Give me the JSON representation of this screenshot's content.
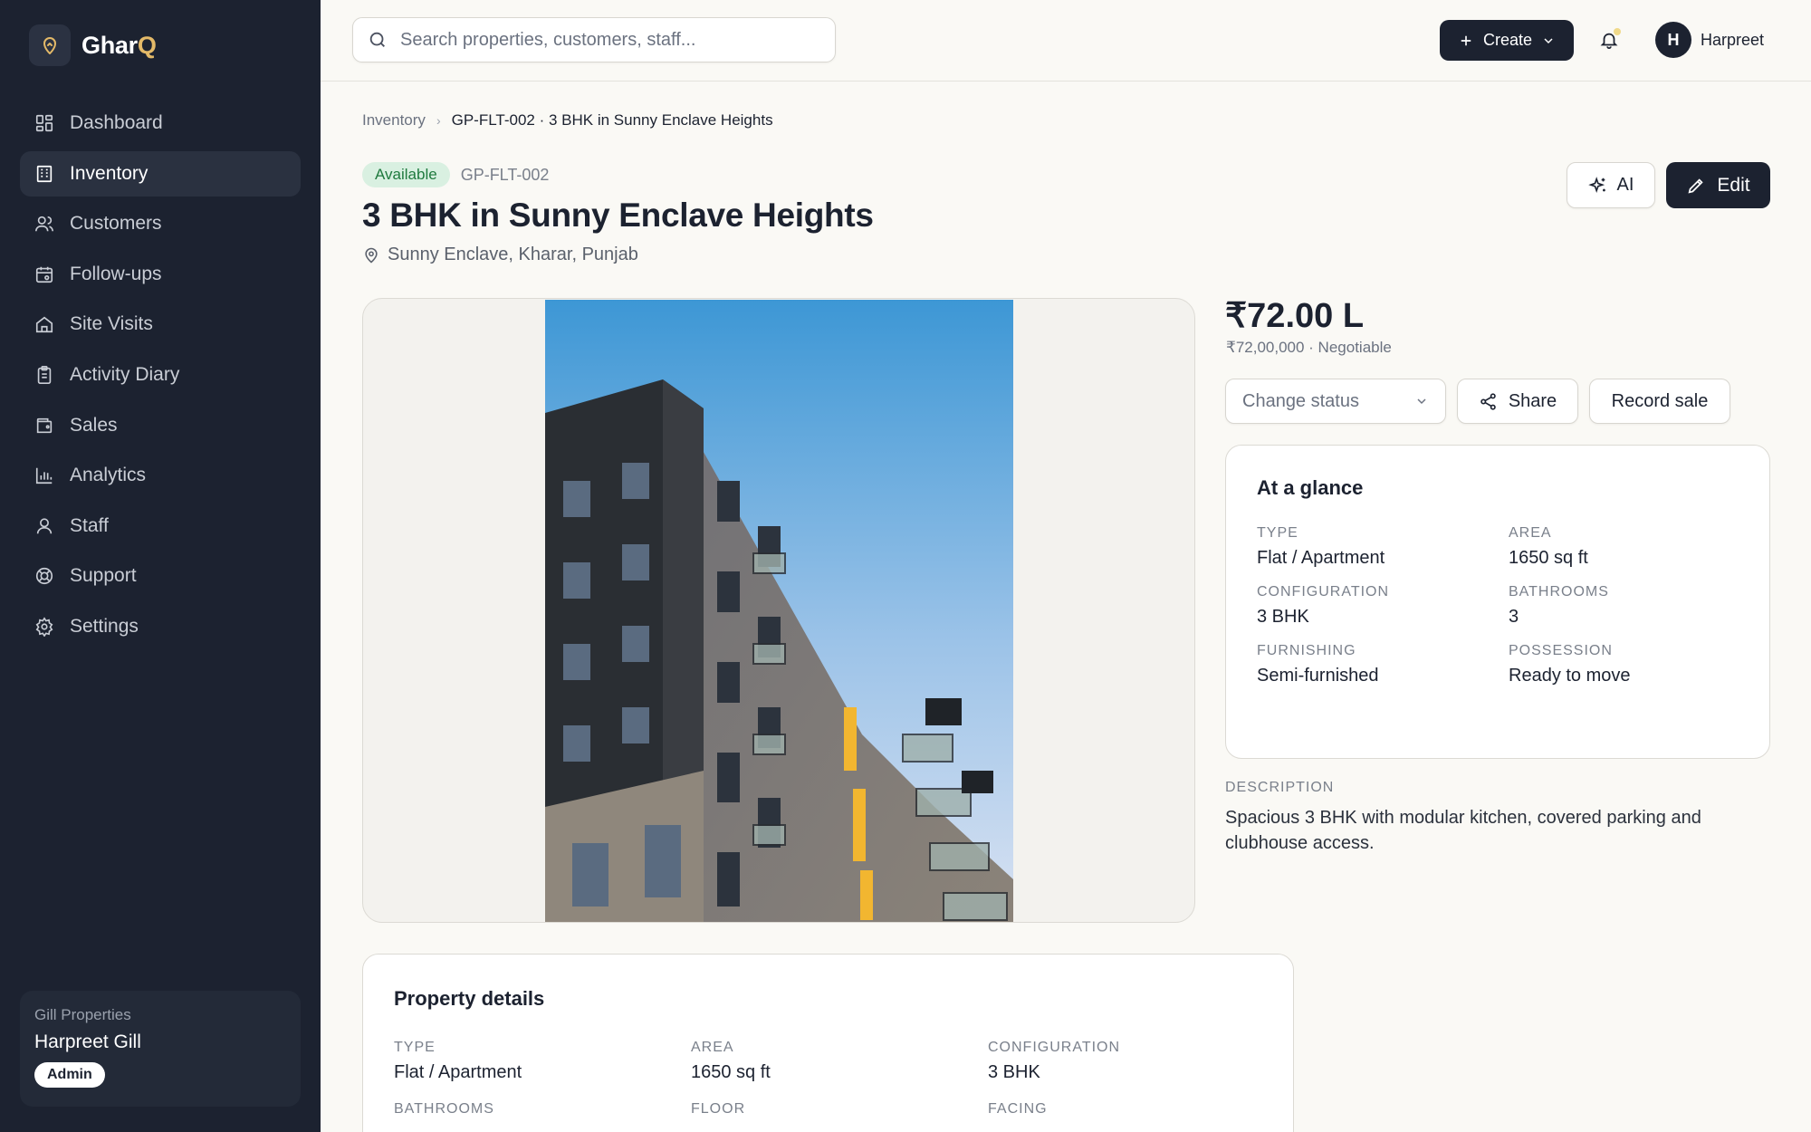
{
  "brand": {
    "name_main": "Ghar",
    "name_accent": "Q"
  },
  "nav": [
    {
      "label": "Dashboard",
      "icon": "dashboard-icon"
    },
    {
      "label": "Inventory",
      "icon": "building-icon",
      "active": true
    },
    {
      "label": "Customers",
      "icon": "users-icon"
    },
    {
      "label": "Follow-ups",
      "icon": "calendar-icon"
    },
    {
      "label": "Site Visits",
      "icon": "home-icon"
    },
    {
      "label": "Activity Diary",
      "icon": "clipboard-icon"
    },
    {
      "label": "Sales",
      "icon": "wallet-icon"
    },
    {
      "label": "Analytics",
      "icon": "bar-chart-icon"
    },
    {
      "label": "Staff",
      "icon": "user-icon"
    },
    {
      "label": "Support",
      "icon": "lifebuoy-icon"
    },
    {
      "label": "Settings",
      "icon": "gear-icon"
    }
  ],
  "org": {
    "name": "Gill Properties",
    "user": "Harpreet Gill",
    "role": "Admin"
  },
  "header": {
    "search_placeholder": "Search properties, customers, staff...",
    "create_label": "Create",
    "avatar_initial": "H",
    "user_name": "Harpreet"
  },
  "breadcrumb": {
    "parent": "Inventory",
    "current": "GP-FLT-002 · 3 BHK in Sunny Enclave Heights"
  },
  "property": {
    "status": "Available",
    "code": "GP-FLT-002",
    "title": "3 BHK in Sunny Enclave Heights",
    "location": "Sunny Enclave, Kharar, Punjab",
    "price": "₹72.00 L",
    "price_sub": "₹72,00,000 · Negotiable"
  },
  "actions": {
    "ai": "AI",
    "edit": "Edit",
    "change_status": "Change status",
    "share": "Share",
    "record_sale": "Record sale"
  },
  "glance": {
    "title": "At a glance",
    "facts": [
      {
        "label": "TYPE",
        "value": "Flat / Apartment"
      },
      {
        "label": "AREA",
        "value": "1650 sq ft"
      },
      {
        "label": "CONFIGURATION",
        "value": "3 BHK"
      },
      {
        "label": "BATHROOMS",
        "value": "3"
      },
      {
        "label": "FURNISHING",
        "value": "Semi-furnished"
      },
      {
        "label": "POSSESSION",
        "value": "Ready to move"
      }
    ]
  },
  "description": {
    "label": "DESCRIPTION",
    "text": "Spacious 3 BHK with modular kitchen, covered parking and clubhouse access."
  },
  "details": {
    "title": "Property details",
    "facts": [
      {
        "label": "TYPE",
        "value": "Flat / Apartment"
      },
      {
        "label": "AREA",
        "value": "1650 sq ft"
      },
      {
        "label": "CONFIGURATION",
        "value": "3 BHK"
      },
      {
        "label": "BATHROOMS",
        "value": ""
      },
      {
        "label": "FLOOR",
        "value": ""
      },
      {
        "label": "FACING",
        "value": ""
      }
    ]
  },
  "colors": {
    "sidebar": "#1c2230",
    "accent": "#e3b968",
    "available_bg": "#d9f0e1",
    "available_fg": "#1f7a3e"
  }
}
